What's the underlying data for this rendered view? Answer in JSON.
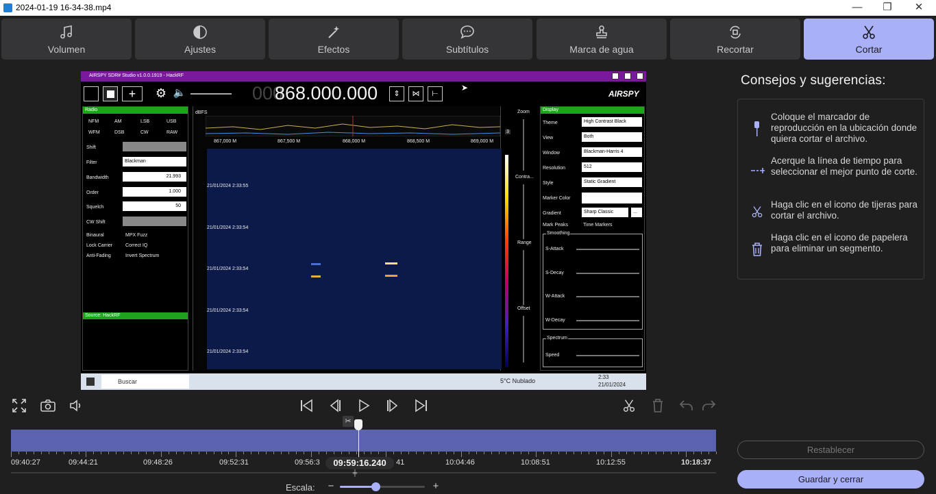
{
  "window": {
    "title": "2024-01-19 16-34-38.mp4",
    "minimize": "—",
    "maximize": "❐",
    "close": "✕"
  },
  "tabs": [
    {
      "label": "Volumen",
      "icon": "music-note-icon"
    },
    {
      "label": "Ajustes",
      "icon": "contrast-icon"
    },
    {
      "label": "Efectos",
      "icon": "magic-wand-icon"
    },
    {
      "label": "Subtítulos",
      "icon": "chat-bubble-icon"
    },
    {
      "label": "Marca de agua",
      "icon": "stamp-icon"
    },
    {
      "label": "Recortar",
      "icon": "crop-rotate-icon"
    },
    {
      "label": "Cortar",
      "icon": "scissors-icon",
      "active": true
    }
  ],
  "video": {
    "app_title": "AIRSPY SDR# Studio v1.0.0.1919 - HackRF",
    "frequency_dim": "000",
    "frequency": "868.000.000",
    "brand": "AIRSPY",
    "radio": {
      "header": "Radio",
      "modes": [
        "NFM",
        "AM",
        "LSB",
        "USB",
        "WFM",
        "DSB",
        "CW",
        "RAW"
      ],
      "shift": "Shift",
      "filter_label": "Filter",
      "filter": "Blackman",
      "bandwidth_label": "Bandwidth",
      "bandwidth": "21.993",
      "order_label": "Order",
      "order": "1.000",
      "squelch_label": "Squelch",
      "squelch": "50",
      "cwshift": "CW Shift",
      "opts": [
        "Binaural",
        "MPX Fuzz",
        "Lock Carrier",
        "Correct IQ",
        "Anti-Fading",
        "Invert Spectrum"
      ]
    },
    "source": "Source: HackRF",
    "spectrum": {
      "dbfs": "dBFS",
      "freqs": [
        "867,000 M",
        "867,500 M",
        "868,000 M",
        "868,500 M",
        "869,000 M"
      ],
      "side": "3"
    },
    "waterfall": [
      "21/01/2024 2:33:55",
      "21/01/2024 2:33:54",
      "21/01/2024 2:33:54",
      "21/01/2024 2:33:54",
      "21/01/2024 2:33:54"
    ],
    "vsliders": [
      "Zoom",
      "Contra...",
      "Range",
      "Offset"
    ],
    "display": {
      "header": "Display",
      "rows": [
        {
          "label": "Theme",
          "value": "High Contrast Black"
        },
        {
          "label": "View",
          "value": "Both"
        },
        {
          "label": "Window",
          "value": "Blackman-Harris 4"
        },
        {
          "label": "Resolution",
          "value": "512"
        },
        {
          "label": "Style",
          "value": "Static Gradient"
        },
        {
          "label": "Marker Color",
          "value": ""
        },
        {
          "label": "Gradient",
          "value": "Sharp Classic"
        }
      ],
      "mark_peaks": "Mark Peaks",
      "time_markers": "Time Markers",
      "smoothing": "Smoothing",
      "smooth": [
        "S-Attack",
        "S-Decay",
        "W-Attack",
        "W-Decay"
      ],
      "spectrum": "Spectrum",
      "speed": "Speed",
      "more": "..."
    },
    "taskbar": {
      "search": "Buscar",
      "weather": "5°C  Nublado",
      "time": "2:33",
      "date": "21/01/2024"
    }
  },
  "tips": {
    "title": "Consejos y sugerencias:",
    "items": [
      {
        "icon": "playhead-marker-icon",
        "text": "Coloque el marcador de reproducción en la ubicación donde quiera cortar el archivo."
      },
      {
        "icon": "zoom-timeline-icon",
        "text": "Acerque la línea de tiempo para seleccionar el mejor punto de corte."
      },
      {
        "icon": "scissors-icon",
        "text": "Haga clic en el icono de tijeras para cortar el archivo."
      },
      {
        "icon": "trash-icon",
        "text": "Haga clic en el icono de papelera para eliminar un segmento."
      }
    ]
  },
  "buttons": {
    "reset": "Restablecer",
    "save": "Guardar y cerrar"
  },
  "timeline": {
    "labels": [
      "09:40:27",
      "09:44:21",
      "09:48:26",
      "09:52:31",
      "09:56:3",
      "41",
      "10:04:46",
      "10:08:51",
      "10:12:55",
      "10:18:37"
    ],
    "current": "09:59:16.240",
    "playhead_fraction": 0.493
  },
  "scale": {
    "label": "Escala:",
    "minus": "−",
    "plus": "+",
    "level": 0.42
  },
  "colors": {
    "accent": "#a9b0f7",
    "timeline": "#5b63b0",
    "bg": "#1f1f20"
  }
}
